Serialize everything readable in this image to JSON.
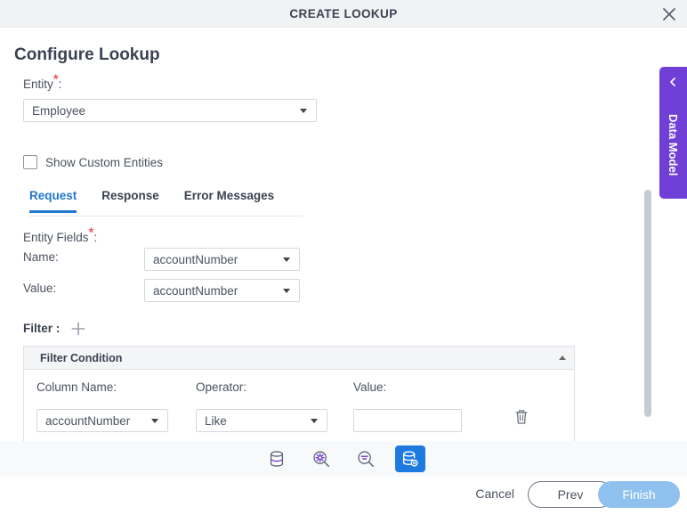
{
  "window": {
    "title": "CREATE LOOKUP",
    "close_icon": "close-icon"
  },
  "page": {
    "title": "Configure Lookup"
  },
  "entity": {
    "label": "Entity",
    "required_marker": "*",
    "colon": ":",
    "selected": "Employee",
    "caret_icon": "chevron-down-icon"
  },
  "custom_entities": {
    "label": "Show Custom Entities",
    "checked": false
  },
  "tabs": [
    {
      "label": "Request",
      "active": true
    },
    {
      "label": "Response",
      "active": false
    },
    {
      "label": "Error Messages",
      "active": false
    }
  ],
  "entity_fields": {
    "label": "Entity Fields",
    "required_marker": "*",
    "colon": ":",
    "name_label": "Name:",
    "name_value": "accountNumber",
    "value_label": "Value:",
    "value_value": "accountNumber"
  },
  "filter": {
    "label": "Filter :",
    "add_icon": "plus-icon"
  },
  "filter_condition": {
    "header": "Filter Condition",
    "collapse_icon": "chevron-up-icon",
    "column_name_label": "Column Name:",
    "operator_label": "Operator:",
    "value_label": "Value:",
    "column_name_value": "accountNumber",
    "operator_value": "Like",
    "value_input": "",
    "value_placeholder": "",
    "delete_icon": "trash-icon"
  },
  "toolbar": {
    "items": [
      {
        "name": "database-icon",
        "selected": false
      },
      {
        "name": "search-gear-icon",
        "selected": false
      },
      {
        "name": "search-filter-icon",
        "selected": false
      },
      {
        "name": "database-gear-icon",
        "selected": true
      }
    ],
    "selected_color": "#1f7ae0",
    "accent_color": "#7a3fd0"
  },
  "footer": {
    "cancel_label": "Cancel",
    "prev_label": "Prev",
    "finish_label": "Finish",
    "finish_color": "#8fc1ef"
  },
  "side_panel": {
    "label": "Data Model",
    "chevron_icon": "chevron-left-icon",
    "color": "#6f3fd6"
  }
}
